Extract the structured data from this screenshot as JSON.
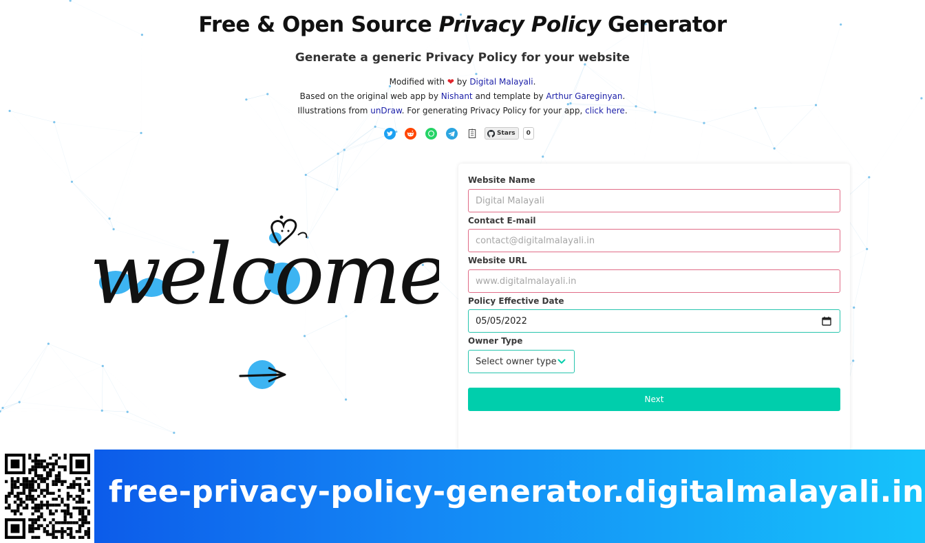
{
  "header": {
    "title_pre": "Free & Open Source ",
    "title_em": "Privacy Policy",
    "title_post": " Generator",
    "subtitle": "Generate a generic Privacy Policy for your website"
  },
  "credits": {
    "line1_pre": "Modified with ",
    "heart": "❤",
    "line1_by": " by ",
    "link_digital_malayali": "Digital Malayali",
    "line1_end": ".",
    "line2_pre": "Based on the original web app by ",
    "link_nishant": "Nishant",
    "line2_mid": " and template by ",
    "link_arthur": "Arthur Gareginyan",
    "line2_end": ".",
    "line3_pre": "Illustrations from ",
    "link_undraw": "unDraw",
    "line3_mid": ". For generating Privacy Policy for your app, ",
    "link_click_here": "click here",
    "line3_end": "."
  },
  "share": {
    "icons": [
      "twitter-icon",
      "reddit-icon",
      "whatsapp-icon",
      "telegram-icon",
      "flag-icon"
    ],
    "github_stars_label": "Stars",
    "github_stars_count": "0"
  },
  "illustration": {
    "welcome_text": "welcome!"
  },
  "form": {
    "website_name_label": "Website Name",
    "website_name_placeholder": "Digital Malayali",
    "email_label": "Contact E-mail",
    "email_placeholder": "contact@digitalmalayali.in",
    "url_label": "Website URL",
    "url_placeholder": "www.digitalmalayali.in",
    "date_label": "Policy Effective Date",
    "date_value": "05/05/2022",
    "owner_label": "Owner Type",
    "owner_selected": "Select owner type",
    "next_label": "Next"
  },
  "banner": {
    "url": "free-privacy-policy-generator.digitalmalayali.in"
  },
  "colors": {
    "accent": "#00ceac",
    "invalid_border": "#e06b86",
    "link": "#1b1fa8",
    "banner_start": "#0a4fe6",
    "banner_end": "#16c3fb",
    "illustration_blue": "#3db4f2"
  }
}
